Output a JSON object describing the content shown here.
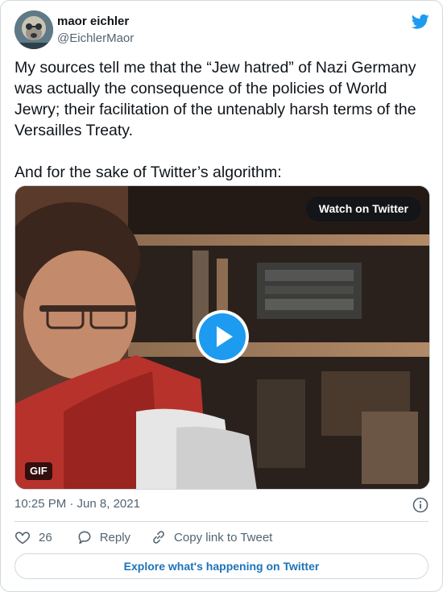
{
  "author": {
    "name": "maor eichler",
    "handle": "@EichlerMaor"
  },
  "tweet": {
    "paragraphs": [
      "My sources tell me that the “Jew hatred” of Nazi Germany was actually the consequence of the policies of World Jewry; their facilitation of the untenably harsh terms of the Versailles Treaty.",
      "And for the sake of Twitter’s algorithm:"
    ]
  },
  "media": {
    "watch_label": "Watch on Twitter",
    "badge": "GIF"
  },
  "meta": {
    "timestamp": "10:25 PM · Jun 8, 2021"
  },
  "actions": {
    "like_count": "26",
    "reply_label": "Reply",
    "copy_label": "Copy link to Tweet"
  },
  "explore_label": "Explore what's happening on Twitter",
  "icons": {
    "brand": "twitter-bird-icon",
    "play": "play-icon",
    "info": "info-icon",
    "like": "heart-icon",
    "reply": "reply-icon",
    "copy": "link-icon"
  },
  "colors": {
    "accent": "#1d9bf0",
    "link": "#1d73b8",
    "secondary_text": "#536471",
    "border": "#cfd9de"
  }
}
